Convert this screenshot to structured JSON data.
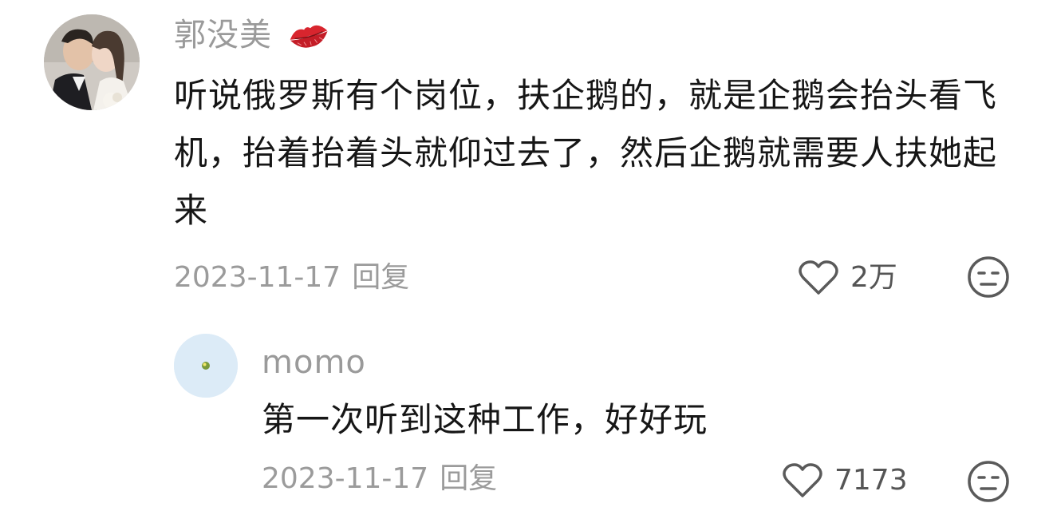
{
  "main_comment": {
    "username": "郭没美",
    "username_badge_icon": "lips-icon",
    "text": "听说俄罗斯有个岗位，扶企鹅的，就是企鹅会抬头看飞机，抬着抬着头就仰过去了，然后企鹅就需要人扶她起来",
    "date": "2023-11-17",
    "reply_label": "回复",
    "like_icon": "heart-outline-icon",
    "like_count": "2万",
    "reaction_icon": "neutral-face-icon"
  },
  "reply": {
    "username": "momo",
    "text": "第一次听到这种工作，好好玩",
    "date": "2023-11-17",
    "reply_label": "回复",
    "like_icon": "heart-outline-icon",
    "like_count": "7173",
    "reaction_icon": "neutral-face-icon"
  },
  "colors": {
    "username": "#9a9a9a",
    "body_text": "#161616",
    "meta_text": "#9b9b9b",
    "icon_stroke": "#5a5a5a",
    "lips": "#d8252e",
    "reply_avatar_bg": "#dcebf7"
  }
}
